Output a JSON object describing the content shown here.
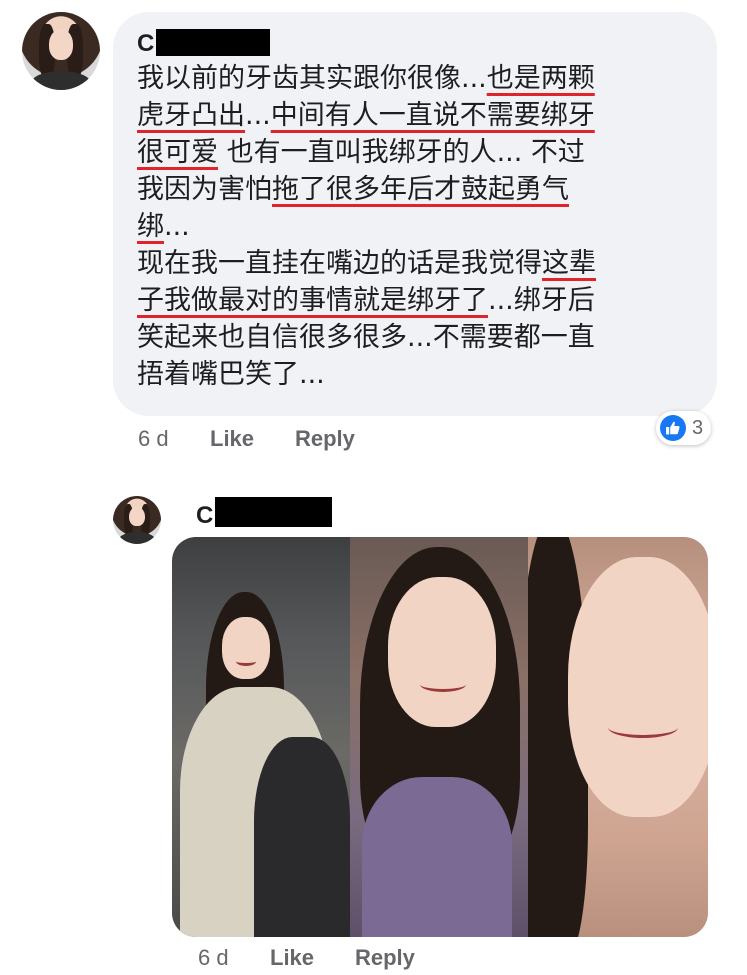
{
  "comments": [
    {
      "author_initial": "C",
      "text_lines": [
        [
          {
            "t": "我以前的牙齿其实跟你很像...",
            "u": false
          },
          {
            "t": "也是两颗",
            "u": true
          }
        ],
        [
          {
            "t": "虎牙凸出",
            "u": true
          },
          {
            "t": "...",
            "u": false
          },
          {
            "t": "中间有人一直说不需要绑牙",
            "u": true
          }
        ],
        [
          {
            "t": "很可爱",
            "u": true
          },
          {
            "t": " 也有一直叫我绑牙的人... 不过",
            "u": false
          }
        ],
        [
          {
            "t": "我因为害怕",
            "u": false
          },
          {
            "t": "拖了很多年后才鼓起勇气",
            "u": true
          }
        ],
        [
          {
            "t": "绑",
            "u": true
          },
          {
            "t": "...",
            "u": false
          }
        ],
        [
          {
            "t": "现在我一直挂在嘴边的话是我觉得",
            "u": false
          },
          {
            "t": "这辈",
            "u": true
          }
        ],
        [
          {
            "t": "子我做最对的事情就是绑牙了",
            "u": true
          },
          {
            "t": "...绑牙后",
            "u": false
          }
        ],
        [
          {
            "t": "笑起来也自信很多很多...不需要都一直",
            "u": false
          }
        ],
        [
          {
            "t": "捂着嘴巴笑了...",
            "u": false
          }
        ]
      ],
      "age": "6 d",
      "like_label": "Like",
      "reply_label": "Reply",
      "reaction_count": "3"
    },
    {
      "author_initial": "C",
      "age": "6 d",
      "like_label": "Like",
      "reply_label": "Reply"
    }
  ],
  "colors": {
    "bubble": "#f0f2f5",
    "underline": "#e0242b",
    "like_blue": "#1877f2",
    "meta_gray": "#65676b"
  },
  "icons": {
    "reaction": "thumbs-up-icon"
  }
}
